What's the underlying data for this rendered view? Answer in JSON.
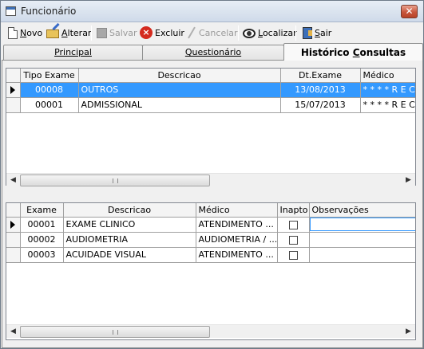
{
  "window": {
    "title": "Funcionário",
    "close_glyph": "✕"
  },
  "toolbar": {
    "novo": {
      "label_u": "N",
      "label_rest": "ovo",
      "icon": "new-document-icon"
    },
    "alterar": {
      "label_u": "A",
      "label_rest": "lterar",
      "icon": "open-folder-icon"
    },
    "salvar": {
      "label": "Salvar",
      "icon": "save-disk-icon"
    },
    "excluir": {
      "label": "Excluir",
      "icon": "delete-icon"
    },
    "cancelar": {
      "label": "Cancelar",
      "icon": "cancel-pen-icon"
    },
    "localizar": {
      "label_u": "L",
      "label_rest": "ocalizar",
      "icon": "eye-icon"
    },
    "sair": {
      "label_u": "S",
      "label_rest": "air",
      "icon": "exit-door-icon"
    }
  },
  "tabs": {
    "principal": "Principal",
    "questionario": "Questionário",
    "historico_pre": "Histórico ",
    "historico_u": "C",
    "historico_post": "onsultas"
  },
  "grid1": {
    "headers": [
      "Tipo Exame",
      "Descricao",
      "Dt.Exame",
      "Médico"
    ],
    "rows": [
      {
        "tipo": "00008",
        "descricao": "OUTROS",
        "data": "13/08/2013",
        "medico": "* * * *   R   E   C"
      },
      {
        "tipo": "00001",
        "descricao": "ADMISSIONAL",
        "data": "15/07/2013",
        "medico": "* * * *   R   E   C"
      }
    ]
  },
  "grid2": {
    "headers": [
      "Exame",
      "Descricao",
      "Médico",
      "Inapto",
      "Observações"
    ],
    "rows": [
      {
        "exame": "00001",
        "descricao": "EXAME CLINICO",
        "medico": "ATENDIMENTO ...",
        "obs": ""
      },
      {
        "exame": "00002",
        "descricao": "AUDIOMETRIA",
        "medico": "AUDIOMETRIA / ...",
        "obs": ""
      },
      {
        "exame": "00003",
        "descricao": "ACUIDADE VISUAL",
        "medico": "ATENDIMENTO ...",
        "obs": ""
      }
    ]
  },
  "scroll": {
    "left_arrow": "◀",
    "right_arrow": "▶"
  },
  "colors": {
    "selection": "#3399ff",
    "close": "#c8553b"
  }
}
